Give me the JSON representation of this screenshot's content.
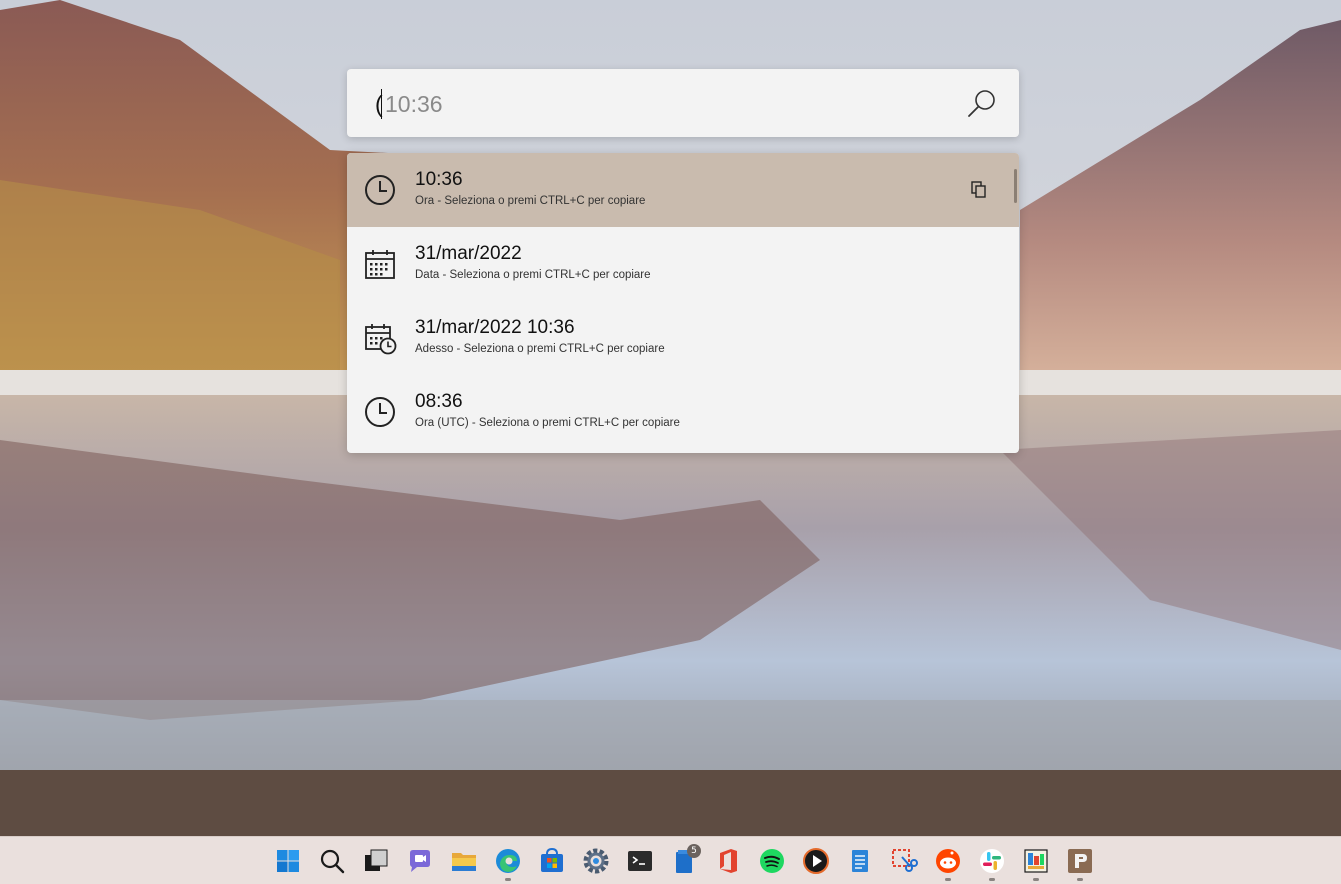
{
  "search": {
    "typed_text": "(",
    "placeholder": "10:36"
  },
  "results": [
    {
      "title": "10:36",
      "subtitle": "Ora - Seleziona o premi CTRL+C per copiare",
      "icon": "clock-icon",
      "selected": true
    },
    {
      "title": "31/mar/2022",
      "subtitle": "Data - Seleziona o premi CTRL+C per copiare",
      "icon": "calendar-icon",
      "selected": false
    },
    {
      "title": "31/mar/2022 10:36",
      "subtitle": "Adesso - Seleziona o premi CTRL+C per copiare",
      "icon": "calendar-clock-icon",
      "selected": false
    },
    {
      "title": "08:36",
      "subtitle": "Ora (UTC) - Seleziona o premi CTRL+C per copiare",
      "icon": "clock-icon",
      "selected": false
    }
  ],
  "taskbar": {
    "icons": [
      "start-icon",
      "search-icon",
      "task-view-icon",
      "teams-chat-icon",
      "file-explorer-icon",
      "edge-icon",
      "store-icon",
      "settings-icon",
      "terminal-icon",
      "notes-icon",
      "office-icon",
      "spotify-icon",
      "media-player-icon",
      "notepad-icon",
      "snipping-tool-icon",
      "reddit-icon",
      "slack-icon",
      "photos-icon",
      "powertoys-icon"
    ],
    "notes_badge": "5"
  },
  "colors": {
    "selected_row": "#c9bbae",
    "panel": "#f3f3f3",
    "taskbar": "#eae0dd"
  }
}
